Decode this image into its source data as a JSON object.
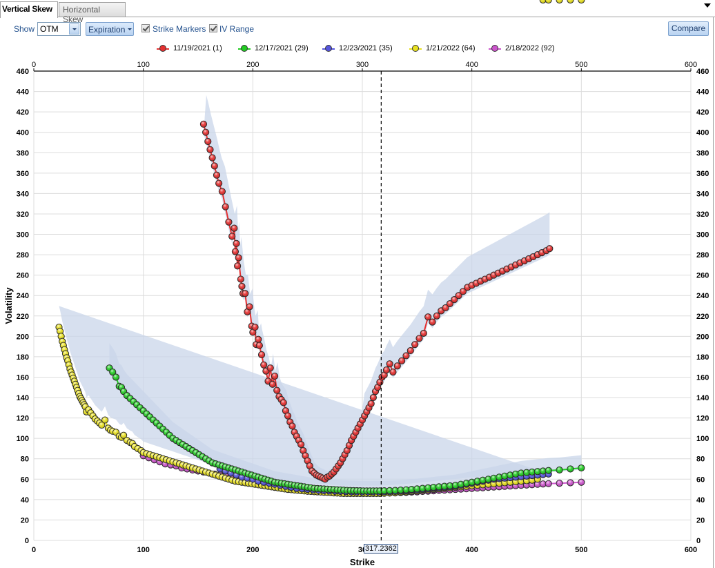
{
  "tabs": [
    {
      "label": "Vertical Skew",
      "active": true
    },
    {
      "label": "Horizontal Skew",
      "active": false
    }
  ],
  "toolbar": {
    "show_label": "Show",
    "show_value": "OTM",
    "expiration_label": "Expiration",
    "strike_markers_label": "Strike Markers",
    "strike_markers_checked": true,
    "iv_range_label": "IV Range",
    "iv_range_checked": true,
    "compare_label": "Compare"
  },
  "cursor": {
    "strike_label": "317.2362",
    "strike": 317.2362
  },
  "chart_data": {
    "type": "line",
    "title": "",
    "xlabel": "Strike",
    "ylabel": "Volatility",
    "xlim": [
      0,
      600
    ],
    "ylim": [
      0,
      460
    ],
    "x_ticks": [
      0,
      100,
      200,
      300,
      400,
      500,
      600
    ],
    "x_tick_labels_top": [
      "0",
      "100",
      "200",
      "300",
      "400",
      "500",
      "600"
    ],
    "x_tick_labels_bottom": [
      "0",
      "100",
      "200",
      "30",
      "400",
      "500",
      "600"
    ],
    "y_ticks": [
      0,
      20,
      40,
      60,
      80,
      100,
      120,
      140,
      160,
      180,
      200,
      220,
      240,
      260,
      280,
      300,
      320,
      340,
      360,
      380,
      400,
      420,
      440,
      460
    ],
    "grid": true,
    "legend_position": "top-center",
    "vertical_marker": 317.2362,
    "series": [
      {
        "name": "11/19/2021 (1)",
        "color": "#e53030",
        "x": [
          155,
          157,
          159,
          161,
          163,
          165,
          167,
          169,
          172,
          175,
          178,
          181,
          183,
          184,
          185,
          186,
          187,
          189,
          190,
          191,
          193,
          195,
          197,
          199,
          200,
          202,
          203,
          205,
          206,
          208,
          210,
          212,
          214,
          216,
          218,
          220,
          222,
          224,
          226,
          228,
          230,
          232,
          234,
          236,
          238,
          240,
          242,
          244,
          246,
          248,
          250,
          252,
          254,
          256,
          258,
          260,
          262,
          264,
          266,
          268,
          270,
          272,
          274,
          276,
          278,
          280,
          282,
          284,
          286,
          288,
          290,
          292,
          294,
          296,
          298,
          300,
          302,
          304,
          306,
          308,
          310,
          312,
          314,
          316,
          318,
          320,
          322,
          325,
          328,
          332,
          336,
          340,
          344,
          348,
          352,
          356,
          360,
          364,
          368,
          372,
          376,
          380,
          384,
          388,
          392,
          396,
          400,
          404,
          408,
          412,
          416,
          420,
          424,
          428,
          432,
          436,
          440,
          444,
          448,
          452,
          456,
          460,
          464,
          468,
          471
        ],
        "y": [
          408,
          400,
          391,
          383,
          375,
          367,
          358,
          350,
          342,
          327,
          312,
          298,
          306,
          283,
          291,
          269,
          277,
          256,
          249,
          242,
          242,
          224,
          229,
          210,
          204,
          209,
          192,
          197,
          191,
          182,
          172,
          166,
          156,
          169,
          153,
          161,
          147,
          141,
          138,
          135,
          127,
          122,
          116,
          112,
          106,
          102,
          98,
          94,
          88,
          83,
          78,
          73,
          68,
          66,
          64,
          63,
          62,
          61,
          60,
          62,
          63,
          65,
          67,
          70,
          73,
          76,
          80,
          84,
          88,
          93,
          98,
          102,
          106,
          110,
          114,
          118,
          122,
          126,
          130,
          134,
          140,
          146,
          150,
          155,
          160,
          162,
          167,
          173,
          165,
          171,
          176,
          181,
          186,
          192,
          198,
          203,
          219,
          214,
          220,
          225,
          228,
          232,
          236,
          240,
          244,
          248,
          250,
          252,
          254,
          256,
          258,
          260,
          262,
          264,
          266,
          268,
          270,
          272,
          274,
          276,
          278,
          280,
          282,
          284,
          286
        ],
        "iv_upper": [],
        "iv_lower": []
      },
      {
        "name": "12/17/2021 (29)",
        "color": "#22cc22",
        "x": [
          69,
          72,
          75,
          78,
          80,
          82,
          85,
          88,
          91,
          94,
          97,
          100,
          103,
          106,
          109,
          112,
          115,
          118,
          121,
          124,
          127,
          130,
          133,
          136,
          139,
          142,
          145,
          148,
          151,
          154,
          157,
          160,
          163,
          166,
          169,
          172,
          175,
          178,
          181,
          184,
          187,
          190,
          193,
          196,
          199,
          202,
          205,
          208,
          211,
          214,
          217,
          220,
          223,
          226,
          229,
          232,
          235,
          238,
          241,
          244,
          247,
          250,
          253,
          256,
          259,
          262,
          265,
          268,
          271,
          274,
          277,
          280,
          283,
          286,
          289,
          292,
          295,
          298,
          301,
          304,
          307,
          310,
          313,
          316,
          320,
          325,
          330,
          335,
          340,
          345,
          350,
          355,
          360,
          365,
          370,
          375,
          380,
          385,
          390,
          395,
          400,
          405,
          410,
          415,
          420,
          425,
          430,
          435,
          440,
          445,
          450,
          455,
          460,
          465,
          470,
          480,
          490,
          500
        ],
        "y": [
          169,
          165,
          160,
          151,
          150,
          146,
          142,
          139,
          136,
          133,
          130,
          127,
          124,
          121,
          118,
          115,
          112,
          109,
          106,
          103,
          100,
          98,
          96,
          94,
          92,
          90,
          88,
          86,
          84,
          82,
          80,
          78,
          76,
          75,
          74,
          73,
          72,
          71,
          70,
          69,
          68,
          67,
          66,
          65,
          64,
          63,
          62,
          61,
          60,
          59,
          58,
          57,
          56.5,
          56,
          55.5,
          55,
          54.5,
          54,
          53.5,
          53,
          52.5,
          52,
          51.5,
          51,
          50.8,
          50.6,
          50.4,
          50.2,
          50,
          49.8,
          49.6,
          49.4,
          49.2,
          49,
          48.9,
          48.8,
          48.7,
          48.6,
          48.5,
          48.5,
          48.5,
          48.5,
          48.5,
          48.5,
          48.6,
          48.8,
          49,
          49.3,
          49.6,
          50,
          50.5,
          51,
          51.5,
          52,
          52.5,
          53,
          53.5,
          54,
          55,
          56,
          57,
          58,
          59,
          60,
          61,
          62,
          63,
          64,
          65,
          66,
          66.5,
          67,
          67.5,
          68,
          68.5,
          69,
          70,
          71,
          72
        ]
      },
      {
        "name": "12/23/2021 (35)",
        "color": "#5555dd",
        "x": [
          170,
          175,
          180,
          185,
          190,
          195,
          200,
          205,
          210,
          215,
          220,
          225,
          230,
          235,
          240,
          245,
          250,
          255,
          260,
          265,
          270,
          275,
          280,
          285,
          290,
          295,
          300,
          305,
          310,
          315,
          320,
          325,
          330,
          335,
          340,
          345,
          350,
          355,
          360,
          365,
          370,
          375,
          380,
          385,
          390,
          395,
          400,
          405,
          410,
          415,
          420,
          425,
          430,
          435,
          440,
          445,
          450,
          455,
          460,
          465,
          470
        ],
        "y": [
          70,
          68,
          66,
          64,
          62,
          61,
          60,
          58,
          57,
          56,
          55,
          54,
          53,
          52,
          51,
          50.5,
          50,
          49.5,
          49,
          48.8,
          48.5,
          48.2,
          48,
          47.8,
          47.6,
          47.5,
          47.5,
          47.5,
          47.5,
          47.5,
          47.6,
          47.8,
          48,
          48.3,
          48.6,
          49,
          49.5,
          50,
          50.5,
          51,
          51.5,
          52,
          52.5,
          53,
          54,
          55,
          56,
          57,
          58,
          59,
          60,
          60.5,
          61,
          61.5,
          62,
          62.5,
          63,
          63.5,
          64,
          64.5,
          65
        ]
      },
      {
        "name": "1/21/2022 (64)",
        "color": "#e8e020",
        "x": [
          23,
          24,
          25,
          26,
          27,
          28,
          29,
          30,
          31,
          32,
          33,
          34,
          35,
          36,
          37,
          38,
          39,
          40,
          41,
          42,
          43,
          44,
          45,
          46,
          47,
          48,
          50,
          52,
          54,
          56,
          58,
          60,
          62,
          65,
          68,
          70,
          72,
          75,
          78,
          80,
          82,
          85,
          88,
          90,
          92,
          95,
          98,
          100,
          103,
          106,
          109,
          112,
          115,
          118,
          121,
          124,
          127,
          130,
          133,
          136,
          139,
          142,
          145,
          148,
          151,
          154,
          157,
          160,
          163,
          166,
          169,
          172,
          175,
          178,
          181,
          184,
          187,
          190,
          193,
          196,
          199,
          202,
          205,
          208,
          211,
          214,
          217,
          220,
          223,
          226,
          229,
          232,
          235,
          238,
          241,
          244,
          247,
          250,
          253,
          256,
          259,
          262,
          265,
          268,
          271,
          274,
          277,
          280,
          283,
          286,
          289,
          292,
          295,
          298,
          301,
          304,
          307,
          310,
          313,
          316,
          320,
          325,
          330,
          335,
          340,
          345,
          350,
          355,
          360,
          365,
          370,
          375,
          380,
          385,
          390,
          395,
          400,
          405,
          410,
          415,
          420,
          425,
          430,
          435,
          440,
          445,
          450,
          455,
          460,
          465,
          470,
          480,
          490,
          500
        ],
        "y": [
          209,
          205,
          200,
          195,
          191,
          187,
          183,
          179,
          176,
          172,
          168,
          165,
          162,
          159,
          156,
          153,
          150,
          147,
          144,
          141,
          139,
          137,
          135,
          133,
          131,
          126,
          128,
          125,
          122,
          119,
          117,
          115,
          113,
          118,
          110,
          108,
          107,
          106,
          102,
          101,
          103,
          98,
          96,
          95,
          92,
          90,
          88,
          86,
          85,
          84,
          83,
          82,
          81,
          80,
          79,
          78,
          77,
          76,
          75,
          74,
          73,
          72,
          71,
          70,
          69,
          68,
          67,
          66,
          65,
          64,
          63,
          62,
          61,
          60,
          59,
          58,
          57.5,
          57,
          56.5,
          56,
          55.5,
          55,
          54.5,
          54,
          53.5,
          53,
          52.5,
          52,
          51.5,
          51,
          50.5,
          50,
          49.7,
          49.4,
          49.1,
          48.8,
          48.5,
          48.2,
          48,
          47.8,
          47.6,
          47.4,
          47.2,
          47,
          46.8,
          46.6,
          46.4,
          46.2,
          46,
          46,
          46,
          46,
          46,
          46,
          46,
          46,
          46,
          46,
          46,
          46,
          46.2,
          46.5,
          46.8,
          47.2,
          47.6,
          48,
          48.5,
          49,
          49.5,
          50,
          50.5,
          51,
          51.5,
          52,
          52.5,
          53,
          53.5,
          54,
          54.5,
          55,
          55.5,
          56,
          56.5,
          57,
          57.5,
          58,
          58.5,
          59,
          60
        ]
      },
      {
        "name": "2/18/2022 (92)",
        "color": "#cc55cc",
        "x": [
          100,
          105,
          110,
          115,
          120,
          125,
          130,
          135,
          140,
          145,
          150,
          155,
          160,
          165,
          170,
          175,
          180,
          185,
          190,
          195,
          200,
          205,
          210,
          215,
          220,
          225,
          230,
          235,
          240,
          245,
          250,
          255,
          260,
          265,
          270,
          275,
          280,
          285,
          290,
          295,
          300,
          305,
          310,
          315,
          320,
          325,
          330,
          335,
          340,
          345,
          350,
          355,
          360,
          365,
          370,
          375,
          380,
          385,
          390,
          395,
          400,
          405,
          410,
          415,
          420,
          425,
          430,
          435,
          440,
          445,
          450,
          455,
          460,
          465,
          470,
          480,
          490,
          500
        ],
        "y": [
          83,
          81,
          79,
          77,
          75,
          74,
          73,
          71,
          70,
          69,
          68,
          67,
          66,
          65,
          64,
          63,
          62,
          61,
          60,
          59,
          58,
          57,
          56,
          55.5,
          55,
          54,
          53,
          52.5,
          52,
          51.5,
          51,
          50.5,
          50,
          49.5,
          49,
          48.5,
          48,
          47.8,
          47.6,
          47.4,
          47.2,
          47,
          46.8,
          46.6,
          46.5,
          46.5,
          46.6,
          46.8,
          47,
          47.3,
          47.6,
          48,
          48.3,
          48.6,
          49,
          49.3,
          49.6,
          50,
          50.3,
          50.6,
          51,
          51.3,
          51.6,
          52,
          52.3,
          52.6,
          53,
          53.3,
          53.6,
          54,
          54.3,
          54.6,
          55,
          55.3,
          55.6,
          56,
          56.5,
          57
        ]
      }
    ],
    "iv_range_band": "shaded light-blue region around each series"
  }
}
